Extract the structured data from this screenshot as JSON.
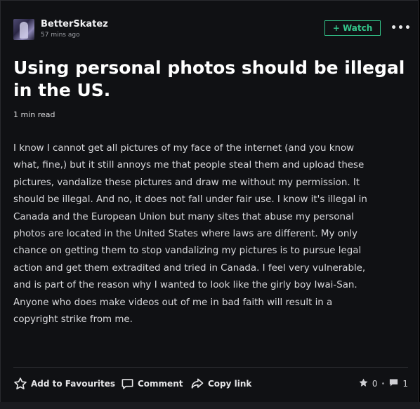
{
  "author": {
    "name": "BetterSkatez",
    "posted": "57 mins ago"
  },
  "header": {
    "watch_label": "+ Watch",
    "more_label": "•••"
  },
  "post": {
    "title": "Using personal photos should be illegal in the US.",
    "read_time": "1 min read",
    "body": "I know I cannot get all pictures of my face of the internet (and you know what, fine,) but it still annoys me that people steal them and upload these pictures, vandalize these pictures and draw me without my permission. It should be illegal. And no, it does not fall under fair use. I know it's illegal in Canada and the European Union but many sites that abuse my personal photos are located in the United States where laws are different. My only chance on getting them to stop vandalizing my pictures is to pursue legal action and get them extradited and tried in Canada. I feel very vulnerable, and is part of the reason why I wanted to look like the girly boy Iwai-San. Anyone who does make videos out of me in bad faith will result in a copyright strike from me."
  },
  "footer": {
    "favourite_label": "Add to Favourites",
    "comment_label": "Comment",
    "copy_label": "Copy link",
    "favourites_count": "0",
    "separator": "•",
    "comments_count": "1"
  },
  "colors": {
    "accent": "#33c48a",
    "background": "#101114"
  },
  "icons": [
    "star-icon",
    "comment-icon",
    "share-arrow-icon",
    "more-icon"
  ]
}
